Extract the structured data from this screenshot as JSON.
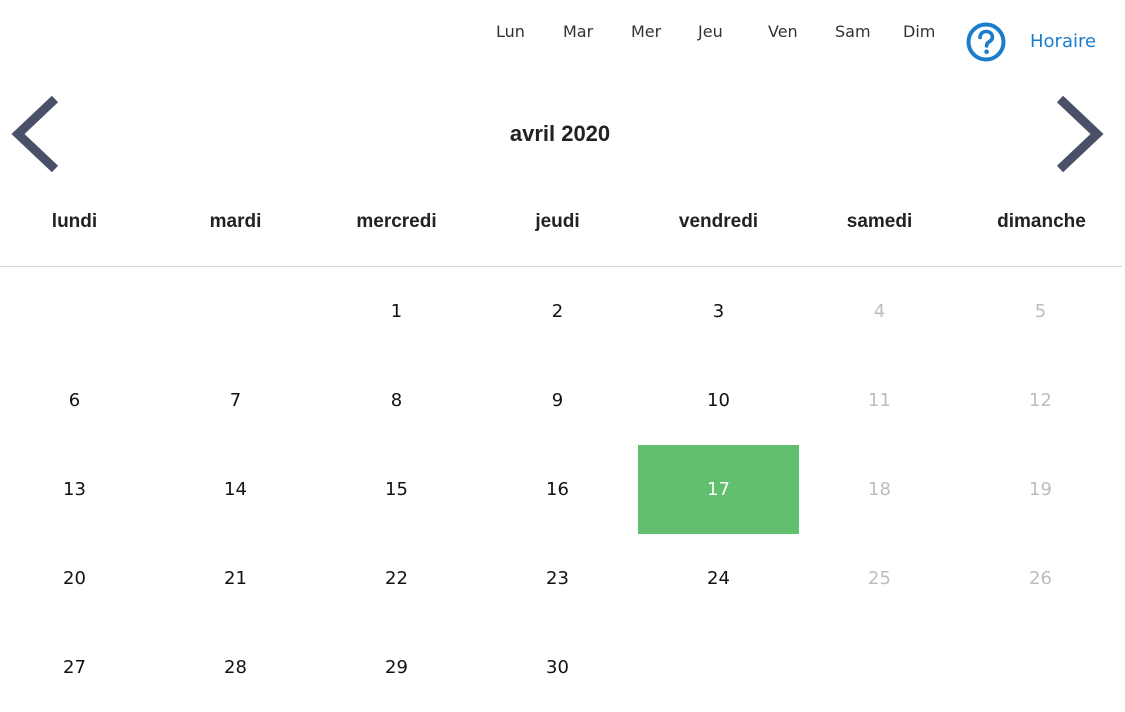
{
  "filter_days": [
    "Lun",
    "Mar",
    "Mer",
    "Jeu",
    "Ven",
    "Sam",
    "Dim"
  ],
  "help_icon": "question-circle-icon",
  "horaire_label": "Horaire",
  "nav": {
    "prev_icon": "chevron-left-icon",
    "next_icon": "chevron-right-icon"
  },
  "month_title": "avril 2020",
  "weekdays": [
    "lundi",
    "mardi",
    "mercredi",
    "jeudi",
    "vendredi",
    "samedi",
    "dimanche"
  ],
  "colors": {
    "accent_blue": "#1a7ccc",
    "selected_green": "#62bf6e",
    "arrow": "#4a5068",
    "disabled_text": "#bdbdbd"
  },
  "selected_date": "17",
  "weeks": [
    [
      {
        "day": "",
        "disabled": false
      },
      {
        "day": "",
        "disabled": false
      },
      {
        "day": "1",
        "disabled": false
      },
      {
        "day": "2",
        "disabled": false
      },
      {
        "day": "3",
        "disabled": false
      },
      {
        "day": "4",
        "disabled": true
      },
      {
        "day": "5",
        "disabled": true
      }
    ],
    [
      {
        "day": "6",
        "disabled": false
      },
      {
        "day": "7",
        "disabled": false
      },
      {
        "day": "8",
        "disabled": false
      },
      {
        "day": "9",
        "disabled": false
      },
      {
        "day": "10",
        "disabled": false
      },
      {
        "day": "11",
        "disabled": true
      },
      {
        "day": "12",
        "disabled": true
      }
    ],
    [
      {
        "day": "13",
        "disabled": false
      },
      {
        "day": "14",
        "disabled": false
      },
      {
        "day": "15",
        "disabled": false
      },
      {
        "day": "16",
        "disabled": false
      },
      {
        "day": "17",
        "disabled": false
      },
      {
        "day": "18",
        "disabled": true
      },
      {
        "day": "19",
        "disabled": true
      }
    ],
    [
      {
        "day": "20",
        "disabled": false
      },
      {
        "day": "21",
        "disabled": false
      },
      {
        "day": "22",
        "disabled": false
      },
      {
        "day": "23",
        "disabled": false
      },
      {
        "day": "24",
        "disabled": false
      },
      {
        "day": "25",
        "disabled": true
      },
      {
        "day": "26",
        "disabled": true
      }
    ],
    [
      {
        "day": "27",
        "disabled": false
      },
      {
        "day": "28",
        "disabled": false
      },
      {
        "day": "29",
        "disabled": false
      },
      {
        "day": "30",
        "disabled": false
      },
      {
        "day": "",
        "disabled": false
      },
      {
        "day": "",
        "disabled": false
      },
      {
        "day": "",
        "disabled": false
      }
    ]
  ]
}
